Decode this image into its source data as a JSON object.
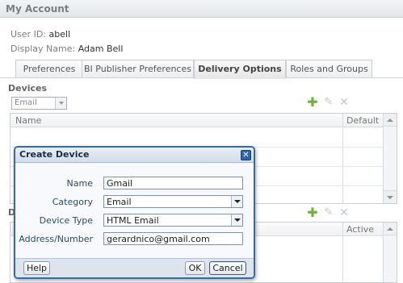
{
  "window": {
    "title": "My Account"
  },
  "account": {
    "user_id_label": "User ID:",
    "user_id": "abell",
    "display_name_label": "Display Name:",
    "display_name": "Adam Bell"
  },
  "tabs": [
    {
      "label": "Preferences",
      "active": false
    },
    {
      "label": "BI Publisher Preferences",
      "active": false
    },
    {
      "label": "Delivery Options",
      "active": true
    },
    {
      "label": "Roles and Groups",
      "active": false
    }
  ],
  "devices": {
    "section_title": "Devices",
    "type_filter": "Email",
    "columns": [
      "Name",
      "Default"
    ]
  },
  "second_grid": {
    "section_title_fragment": "D",
    "columns": [
      "Active"
    ]
  },
  "dialog": {
    "title": "Create Device",
    "fields": {
      "name_label": "Name",
      "name_value": "Gmail",
      "category_label": "Category",
      "category_value": "Email",
      "device_type_label": "Device Type",
      "device_type_value": "HTML Email",
      "address_label": "Address/Number",
      "address_value": "gerardnico@gmail.com"
    },
    "buttons": {
      "help": "Help",
      "ok": "OK",
      "cancel": "Cancel"
    },
    "close_symbol": "✕"
  },
  "icons": {
    "add": "plus-icon",
    "edit": "pencil-icon",
    "delete": "delete-icon"
  },
  "colors": {
    "accent": "#3b6aa3",
    "add_icon": "#6bb534"
  }
}
